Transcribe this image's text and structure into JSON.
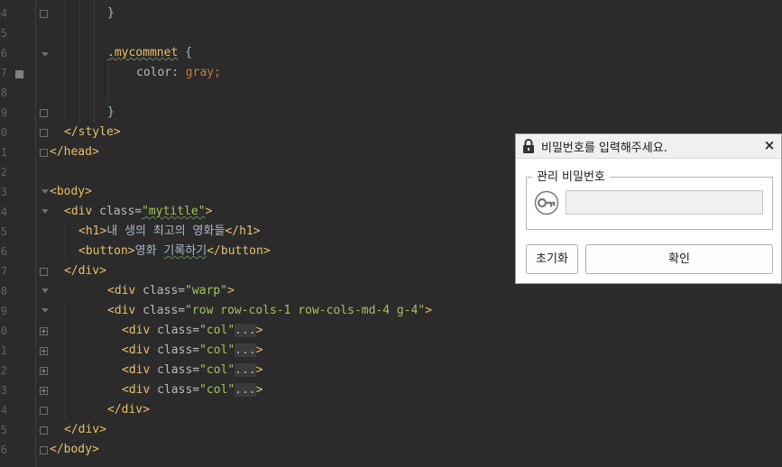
{
  "editor": {
    "line_numbers": [
      "4",
      "5",
      "6",
      "7",
      "8",
      "9",
      "0",
      "1",
      "2",
      "3",
      "4",
      "5",
      "6",
      "7",
      "8",
      "9",
      "0",
      "1",
      "2",
      "3",
      "4",
      "5",
      "6"
    ],
    "lines": {
      "l1_brace": "}",
      "l3_selector": ".mycommnet",
      "l3_brace": " {",
      "l4_prop": "color",
      "l4_colon": ": ",
      "l4_val": "gray;",
      "l6_brace": "}",
      "l7_style_close": "</style>",
      "l8_head_close": "</head>",
      "l10_body_open": "<body>",
      "l11_div_open": "<div ",
      "l11_attr": "class=",
      "l11_val": "\"mytitle\"",
      "l11_end": ">",
      "l12_h1_open": "<h1>",
      "l12_text": "내 생의 최고의 영화들",
      "l12_h1_close": "</h1>",
      "l13_button_open": "<button>",
      "l13_text_a": "영화 ",
      "l13_text_b": "기록하기",
      "l13_button_close": "</button>",
      "l14_div_close": "</div>",
      "l15_div_open": "<div ",
      "l15_attr": "class=",
      "l15_val": "\"warp\"",
      "l15_end": ">",
      "l16_div_open": "<div ",
      "l16_attr": "class=",
      "l16_val": "\"row row-cols-1 row-cols-md-4 g-4\"",
      "l16_end": ">",
      "col_div_open": "<div ",
      "col_attr": "class=",
      "col_val": "\"col\"",
      "col_dots": "...",
      "col_end": ">",
      "l21_div_close": "</div>",
      "l22_div_close": "</div>",
      "l23_body_close": "</body>"
    }
  },
  "dialog": {
    "title": "비밀번호를 입력해주세요.",
    "close_label": "×",
    "group_label": "관리 비밀번호",
    "password_value": "",
    "reset_label": "초기화",
    "ok_label": "확인"
  },
  "colors": {
    "editor_bg": "#2b2b2b",
    "tag": "#e8bf6a",
    "string": "#a5c25c",
    "text": "#a9b7c6"
  },
  "icons": {
    "lock": "lock-icon",
    "key": "key-icon",
    "close": "close-icon"
  }
}
